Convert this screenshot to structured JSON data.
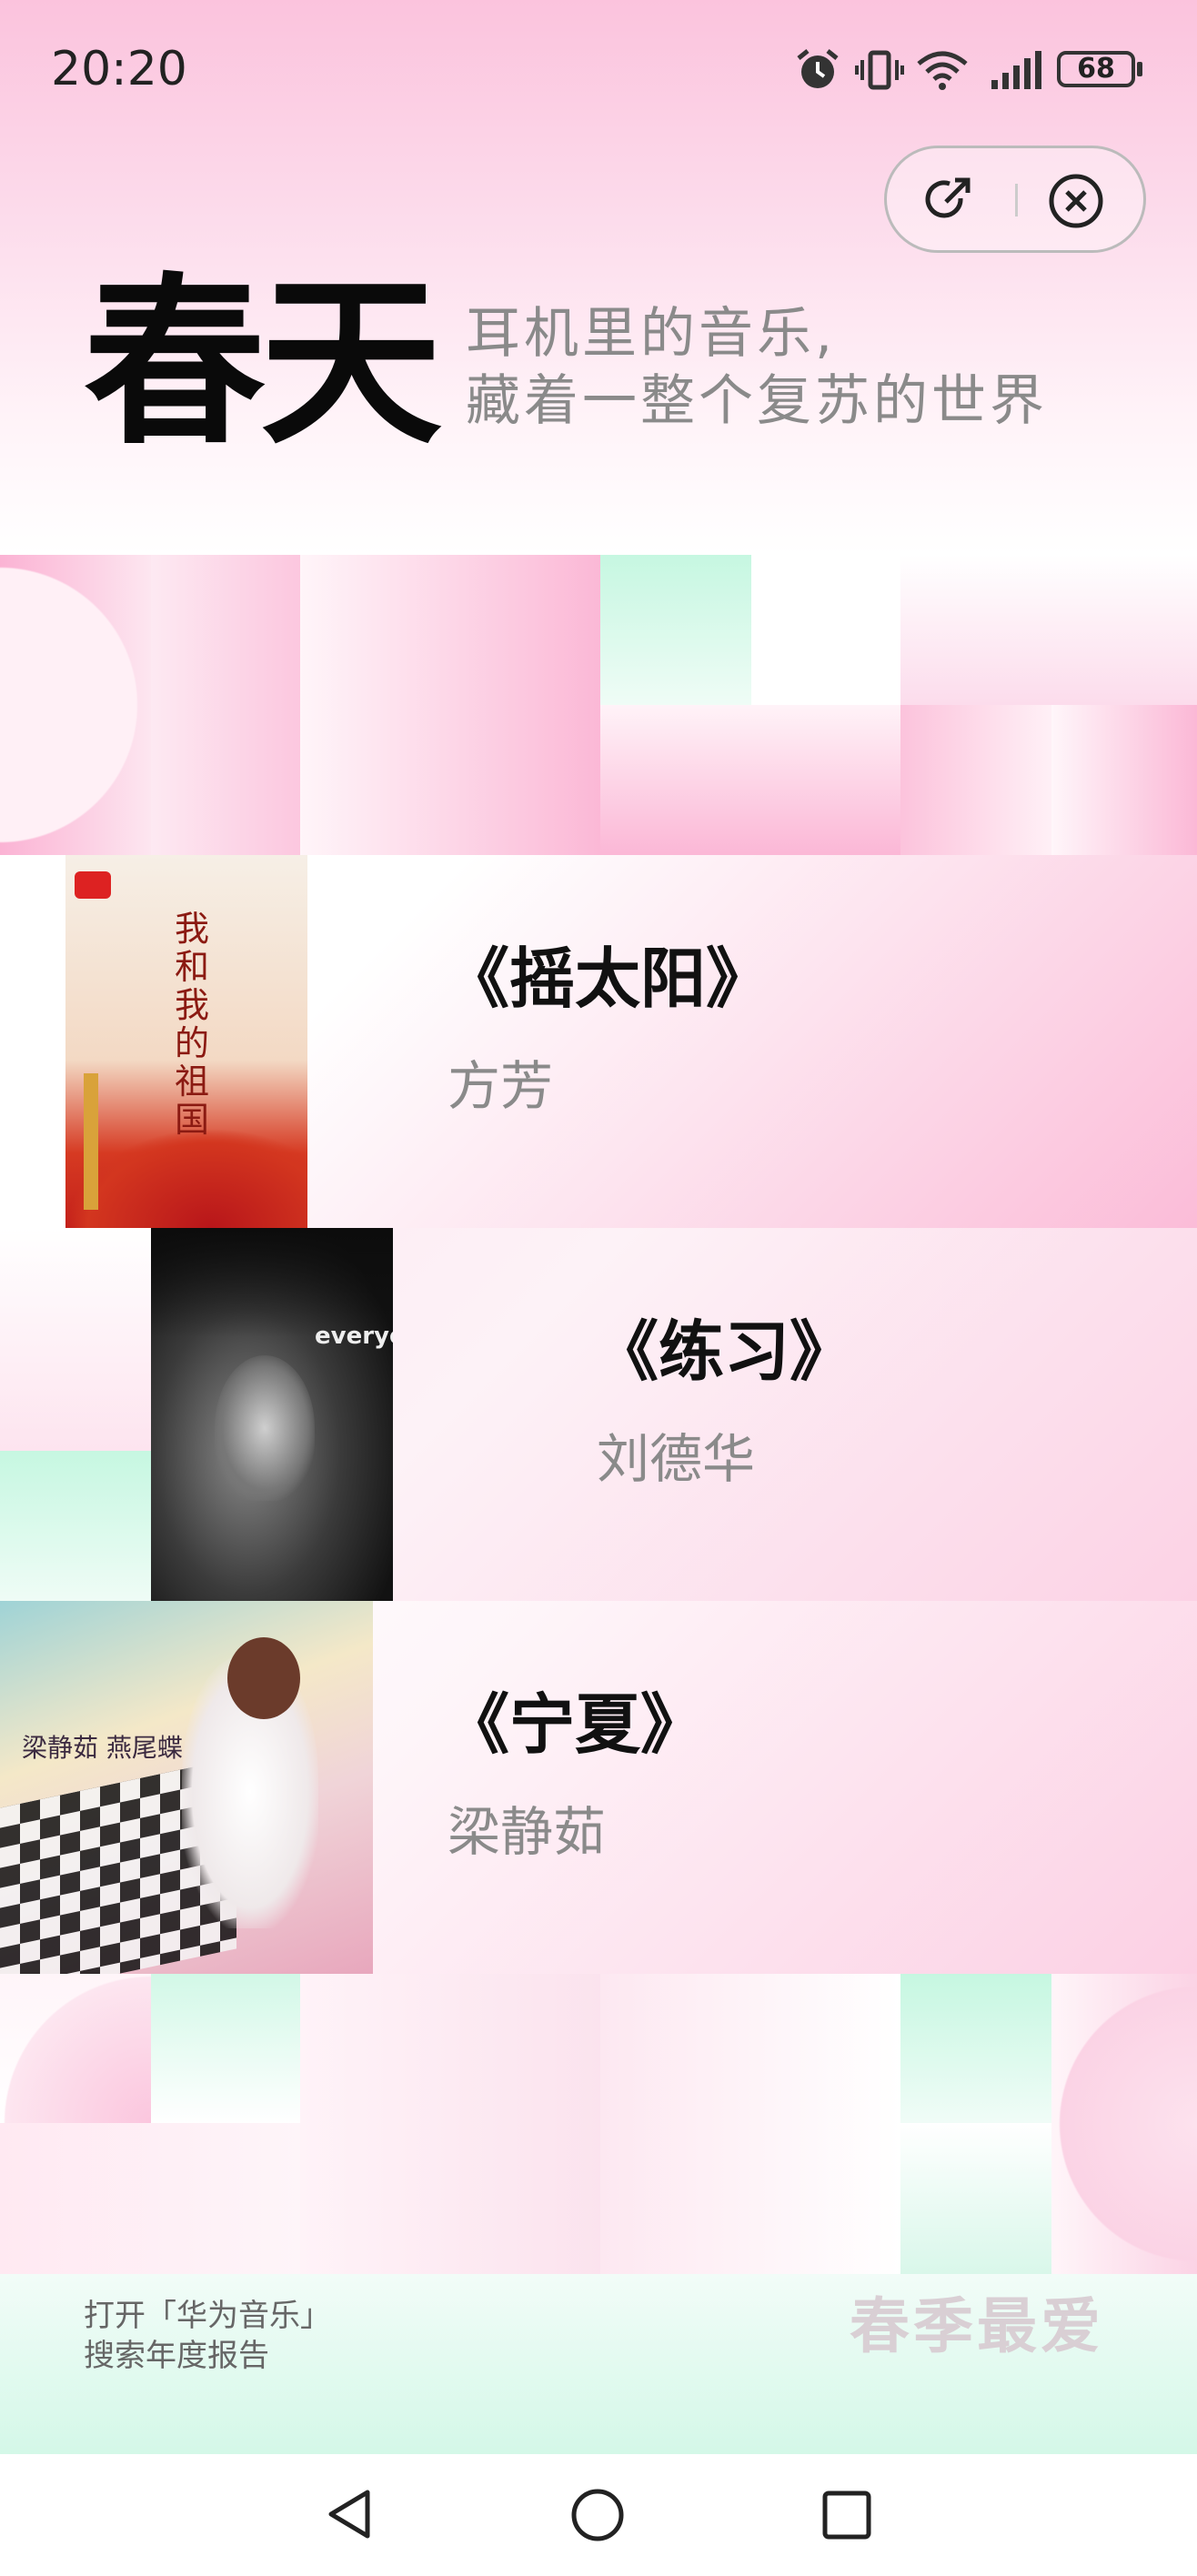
{
  "status_bar": {
    "time": "20:20",
    "battery": "68"
  },
  "header": {
    "title": "春天",
    "subtitle_line1": "耳机里的音乐,",
    "subtitle_line2": "藏着一整个复苏的世界"
  },
  "songs": [
    {
      "title": "《摇太阳》",
      "artist": "方芳",
      "cover_text": "我和我的祖国"
    },
    {
      "title": "《练习》",
      "artist": "刘德华",
      "cover_text": "everyone is"
    },
    {
      "title": "《宁夏》",
      "artist": "梁静茹",
      "cover_text": "梁静茹 燕尾蝶"
    }
  ],
  "footer": {
    "line1": "打开「华为音乐」",
    "line2": "搜索年度报告",
    "season_label": "春季最爱"
  },
  "icons": [
    "alarm-icon",
    "vibrate-icon",
    "wifi-icon",
    "signal-icon",
    "battery-icon",
    "share-icon",
    "close-icon",
    "back-icon",
    "home-icon",
    "recents-icon"
  ],
  "colors": {
    "pink": "#fbb3d4",
    "mint": "#c6f7e1",
    "title": "#0a0a0a",
    "subtitle": "#8a8a8a"
  }
}
